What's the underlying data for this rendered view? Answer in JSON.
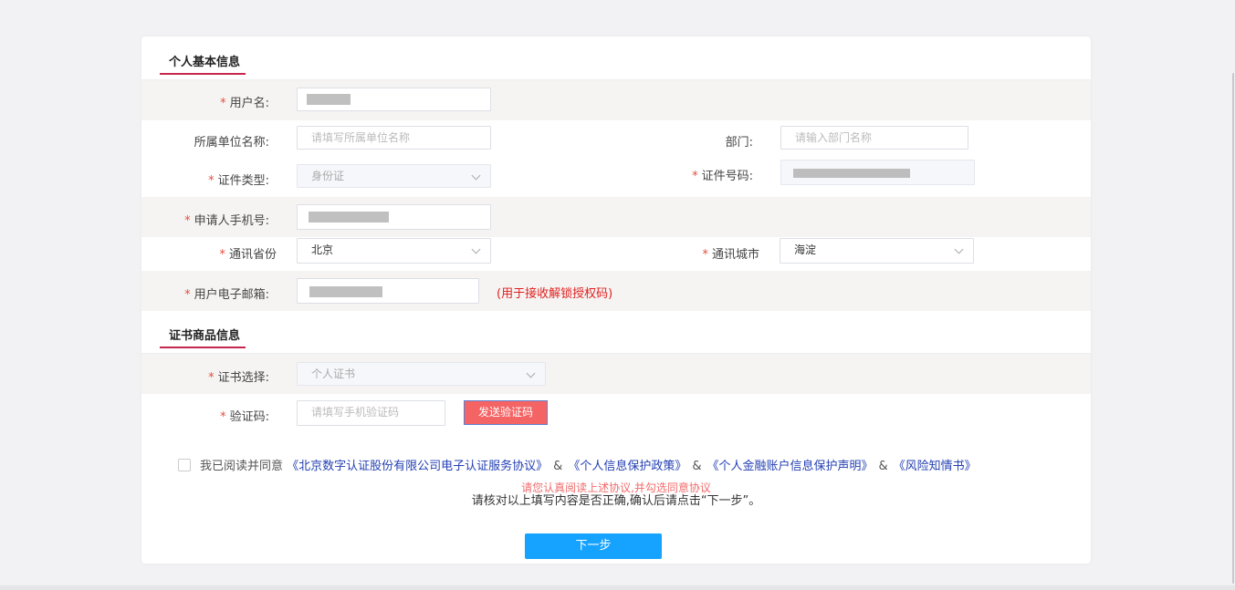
{
  "section_personal": {
    "title": "个人基本信息"
  },
  "section_cert": {
    "title": "证书商品信息"
  },
  "fields": {
    "username": {
      "label": "用户名:",
      "required": "*"
    },
    "org": {
      "label": "所属单位名称:",
      "placeholder": "请填写所属单位名称"
    },
    "dept": {
      "label": "部门:",
      "placeholder": "请输入部门名称"
    },
    "id_type": {
      "label": "证件类型:",
      "required": "*",
      "value": "身份证"
    },
    "id_number": {
      "label": "证件号码:",
      "required": "*"
    },
    "phone": {
      "label": "申请人手机号:",
      "required": "*"
    },
    "province": {
      "label": "通讯省份",
      "required": "*",
      "value": "北京"
    },
    "city": {
      "label": "通讯城市",
      "required": "*",
      "value": "海淀"
    },
    "email": {
      "label": "用户电子邮箱:",
      "required": "*",
      "hint": "(用于接收解锁授权码)"
    },
    "cert_select": {
      "label": "证书选择:",
      "required": "*",
      "value": "个人证书"
    },
    "verify_code": {
      "label": "验证码:",
      "required": "*",
      "placeholder": "请填写手机验证码"
    }
  },
  "buttons": {
    "send_code": "发送验证码",
    "next": "下一步"
  },
  "agreement": {
    "prefix": "我已阅读并同意",
    "link1": "《北京数字认证股份有限公司电子认证服务协议》",
    "link2": "《个人信息保护政策》",
    "link3": "《个人金融账户信息保护声明》",
    "link4": "《风险知情书》",
    "amp": "&",
    "warning": "请您认真阅读上述协议,并勾选同意协议"
  },
  "confirm_text": "请核对以上填写内容是否正确,确认后请点击“下一步”。"
}
